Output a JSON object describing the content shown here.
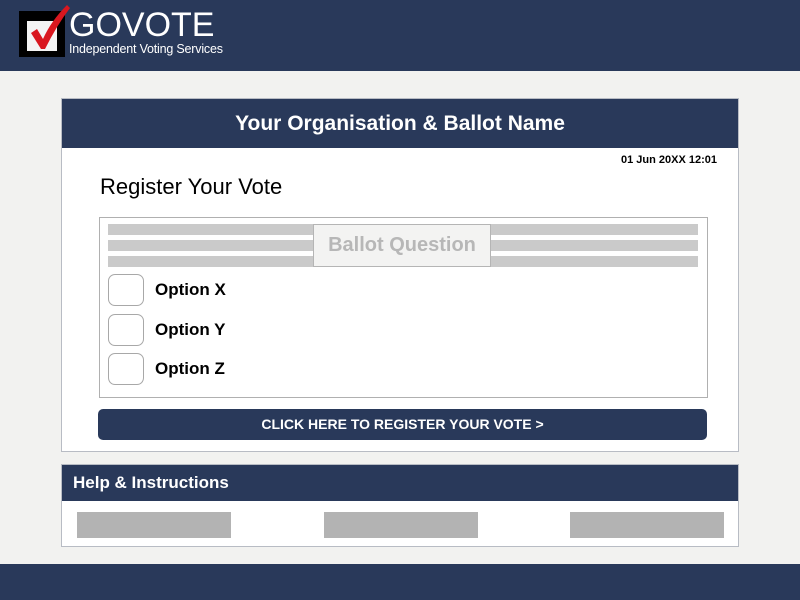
{
  "header": {
    "logo_title": "GOVOTE",
    "logo_subtitle": "Independent Voting Services"
  },
  "ballot": {
    "title": "Your Organisation & Ballot Name",
    "timestamp": "01 Jun 20XX 12:01",
    "heading": "Register Your Vote",
    "question_label": "Ballot Question",
    "options": [
      {
        "label": "Option X",
        "checked": false
      },
      {
        "label": "Option Y",
        "checked": false
      },
      {
        "label": "Option Z",
        "checked": false
      }
    ],
    "submit_label": "CLICK HERE TO REGISTER YOUR VOTE >"
  },
  "help": {
    "title": "Help & Instructions",
    "links": [
      "",
      "",
      ""
    ]
  },
  "colors": {
    "brand_navy": "#29395a",
    "checkmark_red": "#d9171f",
    "placeholder_gray": "#b3b3b3",
    "background": "#f2f2f0"
  }
}
